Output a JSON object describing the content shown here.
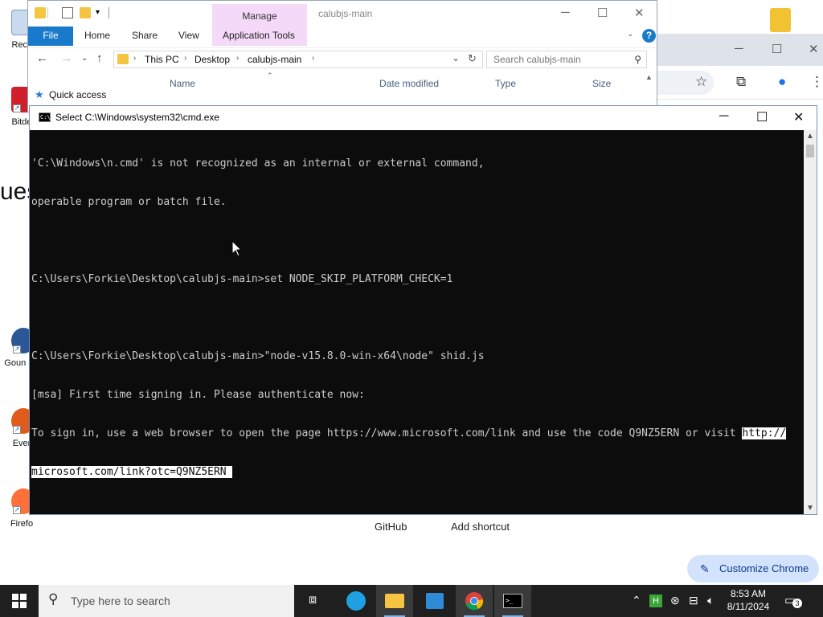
{
  "desktop": {
    "icons": [
      {
        "label": "Recy",
        "color": "#3a7bd5"
      },
      {
        "label": "Bitde",
        "color": "#d21f2b"
      },
      {
        "label": "Goun So",
        "color": "#2b5797"
      },
      {
        "label": "Ever",
        "color": "#e05c1c"
      },
      {
        "label": "Firefo",
        "color": "#ff7139"
      }
    ],
    "partial_text": "ues"
  },
  "explorer": {
    "window_title": "calubjs-main",
    "manage_tab": "Manage",
    "ribbon_tabs": [
      "File",
      "Home",
      "Share",
      "View",
      "Application Tools"
    ],
    "breadcrumb": [
      "This PC",
      "Desktop",
      "calubjs-main"
    ],
    "search_placeholder": "Search calubjs-main",
    "columns": [
      "Name",
      "Date modified",
      "Type",
      "Size"
    ],
    "quick_access": "Quick access"
  },
  "chrome": {
    "shortcuts": [
      "GitHub",
      "Add shortcut"
    ],
    "customize_label": "Customize Chrome"
  },
  "cmd": {
    "title": "Select C:\\Windows\\system32\\cmd.exe",
    "lines": [
      "'C:\\Windows\\n.cmd' is not recognized as an internal or external command,",
      "operable program or batch file.",
      "",
      "C:\\Users\\Forkie\\Desktop\\calubjs-main>set NODE_SKIP_PLATFORM_CHECK=1",
      "",
      "C:\\Users\\Forkie\\Desktop\\calubjs-main>\"node-v15.8.0-win-x64\\node\" shid.js",
      "[msa] First time signing in. Please authenticate now:"
    ],
    "signin_line_text": "To sign in, use a web browser to open the page https://www.microsoft.com/link and use the code Q9NZ5ERN or visit ",
    "signin_line_selected": "http://",
    "selected_continuation": "microsoft.com/link?otc=Q9NZ5ERN "
  },
  "taskbar": {
    "search_placeholder": "Type here to search",
    "time": "8:53 AM",
    "date": "8/11/2024",
    "notification_count": "3"
  },
  "colors": {
    "console_bg": "#0c0c0c",
    "console_fg": "#cccccc",
    "taskbar_bg": "#1f1f1f",
    "file_tab": "#1979ca",
    "manage_tab": "#f5d9f8",
    "customize_bg": "#d3e3fd"
  }
}
